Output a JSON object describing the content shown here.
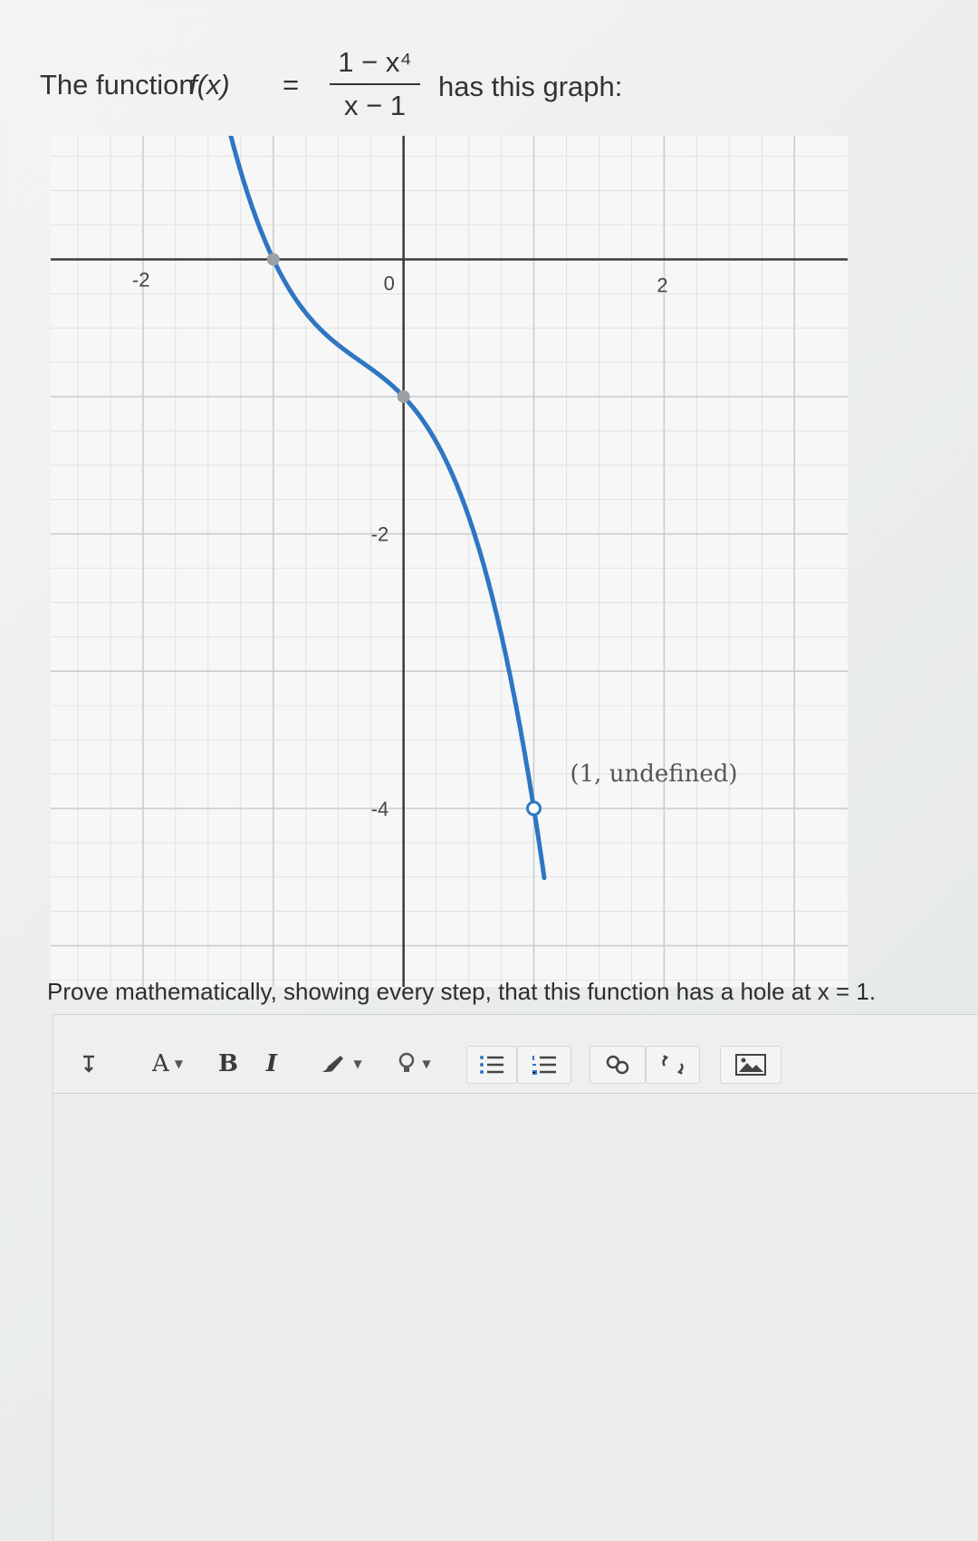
{
  "question": {
    "prefix": "The function",
    "fx": "f(x)",
    "equals": "=",
    "numerator": "1 − x⁴",
    "denominator": "x − 1",
    "suffix": "has this graph:"
  },
  "graph": {
    "tick_labels": {
      "x_neg2": "-2",
      "x_0": "0",
      "x_2": "2",
      "y_neg2": "-2",
      "y_neg4": "-4"
    },
    "hole_label": "(1, undefined)",
    "colors": {
      "curve": "#2f76c2",
      "axis": "#3a3a3a",
      "grid": "#d9dcdc",
      "hole_fill": "#ffffff"
    }
  },
  "chart_data": {
    "type": "line",
    "title": "",
    "xlabel": "",
    "ylabel": "",
    "xlim": [
      -2.5,
      3.2
    ],
    "ylim": [
      -5.3,
      0.9
    ],
    "grid": true,
    "series": [
      {
        "function": "-(x+1)(x^2+1)",
        "x_range": [
          -1.7,
          1.08
        ]
      }
    ],
    "marked_points": [
      {
        "x": -1,
        "y": 0,
        "style": "gray-dot"
      },
      {
        "x": 0,
        "y": -1,
        "style": "gray-dot"
      },
      {
        "x": 1,
        "y": -4,
        "style": "open-circle",
        "label": "(1, undefined)"
      }
    ]
  },
  "prompt": "Prove mathematically, showing every step, that this function has a hole at x = 1.",
  "toolbar": {
    "a_label": "A",
    "bold_label": "B",
    "italic_label": "I",
    "icons": [
      "paragraph-icon",
      "font-color-icon",
      "bold-icon",
      "italic-icon",
      "highlight-brush-icon",
      "lightbulb-icon",
      "bulleted-list-icon",
      "numbered-list-icon",
      "link-icon",
      "unlink-icon",
      "image-icon"
    ]
  }
}
